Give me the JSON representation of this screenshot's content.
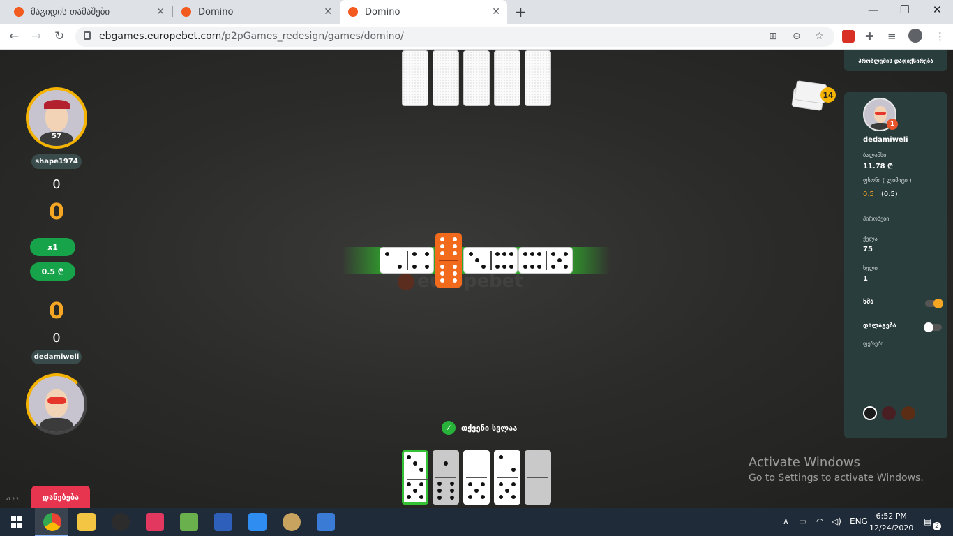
{
  "browser": {
    "tabs": [
      {
        "title": "მაგიდის თამაშები"
      },
      {
        "title": "Domino"
      },
      {
        "title": "Domino"
      }
    ],
    "url_host": "ebgames.europebet.com",
    "url_path": "/p2pGames_redesign/games/domino/"
  },
  "game": {
    "opponent": {
      "name": "shape1974",
      "level": "57",
      "score_small": "0",
      "score_big": "0"
    },
    "multiplier": "x1",
    "stake": "0.5 ₾",
    "player": {
      "name": "dedamiweli",
      "score_big": "0",
      "score_small": "0"
    },
    "exit_label": "დანებება",
    "version": "v1.2.2",
    "turn_text": "თქვენი სვლაა",
    "boneyard_count": "14",
    "board_tiles": [
      [
        2,
        4
      ],
      [
        6,
        6
      ],
      [
        3,
        6
      ],
      [
        6,
        5
      ]
    ],
    "hand_tiles": [
      [
        3,
        5
      ],
      [
        1,
        6
      ],
      [
        0,
        5
      ],
      [
        2,
        5
      ],
      [
        0,
        0
      ]
    ],
    "watermark": "europebet"
  },
  "panel": {
    "report_label": "პრობლემის დაფიქსირება",
    "username": "dedamiweli",
    "badge": "1",
    "balance_label": "ბალანსი",
    "balance_value": "11.78 ₾",
    "bet_label": "ფსონი ( ლიმიტი )",
    "bet_value": "0.5",
    "bet_limit": "(0.5)",
    "conditions_label": "პირობები",
    "points_label": "ქულა",
    "points_value": "75",
    "hands_label": "ხელი",
    "hands_value": "1",
    "sound_label": "ხმა",
    "sound_on": true,
    "hint_label": "დალაგება",
    "hint_on": false,
    "colors_label": "ფერები",
    "colors": [
      "#1b1b1b",
      "#4a1f24",
      "#5a2d14"
    ]
  },
  "activation": {
    "title": "Activate Windows",
    "subtitle": "Go to Settings to activate Windows."
  },
  "taskbar": {
    "lang": "ENG",
    "time": "6:52 PM",
    "date": "12/24/2020",
    "notifications": "2"
  }
}
